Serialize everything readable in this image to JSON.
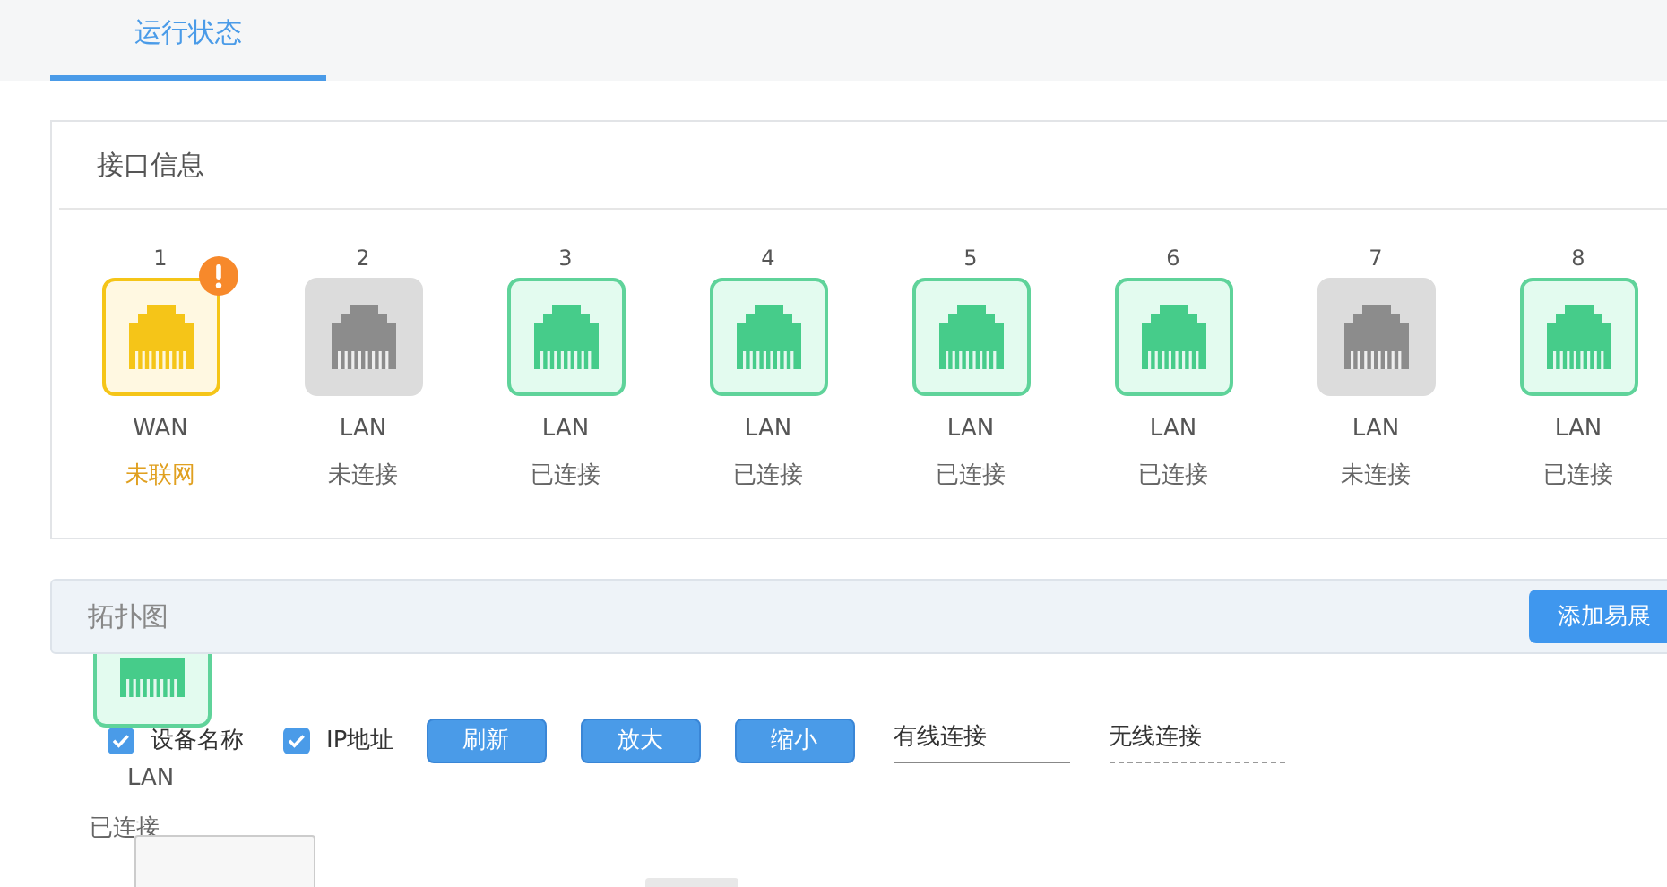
{
  "tabs": [
    {
      "label": "运行状态",
      "selected": true
    }
  ],
  "interface_panel": {
    "title": "接口信息",
    "ports": [
      {
        "number": "1",
        "type": "WAN",
        "status": "未联网",
        "kind": "warning",
        "alert": true
      },
      {
        "number": "2",
        "type": "LAN",
        "status": "未连接",
        "kind": "disconnected",
        "alert": false
      },
      {
        "number": "3",
        "type": "LAN",
        "status": "已连接",
        "kind": "connected",
        "alert": false
      },
      {
        "number": "4",
        "type": "LAN",
        "status": "已连接",
        "kind": "connected",
        "alert": false
      },
      {
        "number": "5",
        "type": "LAN",
        "status": "已连接",
        "kind": "connected",
        "alert": false
      },
      {
        "number": "6",
        "type": "LAN",
        "status": "已连接",
        "kind": "connected",
        "alert": false
      },
      {
        "number": "7",
        "type": "LAN",
        "status": "未连接",
        "kind": "disconnected",
        "alert": false
      },
      {
        "number": "8",
        "type": "LAN",
        "status": "已连接",
        "kind": "connected",
        "alert": false
      }
    ]
  },
  "topology_panel": {
    "title": "拓扑图",
    "add_button": "添加易展",
    "options": [
      {
        "label": "设备名称",
        "checked": true
      },
      {
        "label": "IP地址",
        "checked": true
      }
    ],
    "buttons": [
      "刷新",
      "放大",
      "缩小"
    ],
    "view_tabs": [
      {
        "label": "有线连接",
        "selected": true
      },
      {
        "label": "无线连接",
        "selected": false
      }
    ],
    "dragged_port": {
      "type": "LAN",
      "status": "已连接",
      "kind": "connected"
    }
  }
}
